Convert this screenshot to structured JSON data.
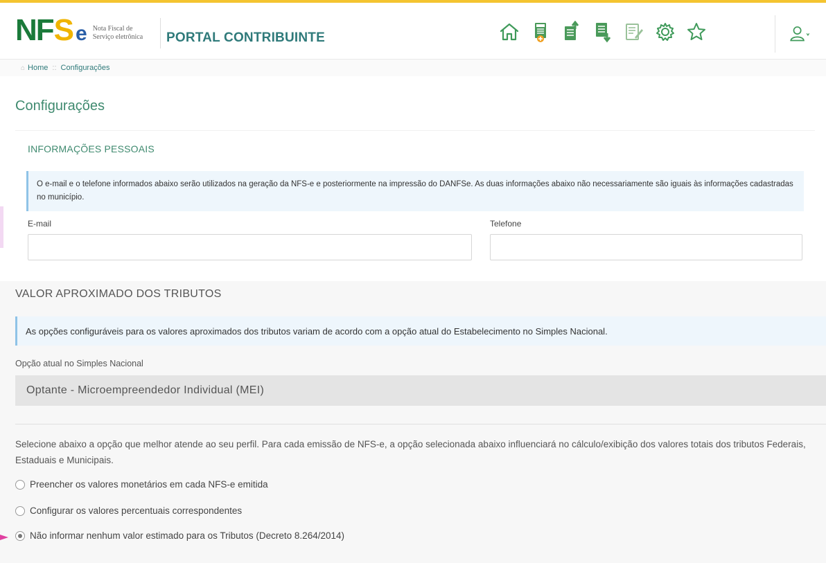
{
  "header": {
    "logo_nf": "NF",
    "logo_s": "S",
    "logo_e": "e",
    "logo_sub_1": "Nota Fiscal de",
    "logo_sub_2": "Serviço eletrônica",
    "portal_title": "PORTAL CONTRIBUINTE",
    "nav_icons": [
      "home-icon",
      "new-invoice-icon",
      "upload-invoice-icon",
      "download-invoice-icon",
      "edit-document-icon",
      "gear-icon",
      "star-icon"
    ],
    "accent_color": "#3f8a6f"
  },
  "breadcrumb": {
    "home": "Home",
    "separator": "::",
    "current": "Configurações"
  },
  "page": {
    "title": "Configurações"
  },
  "personal_info": {
    "title": "INFORMAÇÕES PESSOAIS",
    "notice": "O e-mail e o telefone informados abaixo serão utilizados na geração da NFS-e e posteriormente na impressão do DANFSe. As duas informações abaixo não necessariamente são iguais às informações cadastradas no município.",
    "email_label": "E-mail",
    "email_value": "",
    "phone_label": "Telefone",
    "phone_value": ""
  },
  "taxes": {
    "title": "VALOR APROXIMADO DOS TRIBUTOS",
    "notice": "As opções configuráveis para os valores aproximados dos tributos variam de acordo com a opção atual do Estabelecimento no Simples Nacional.",
    "simples_label": "Opção atual no Simples Nacional",
    "simples_value": "Optante - Microempreendedor Individual (MEI)",
    "description": "Selecione abaixo a opção que melhor atende ao seu perfil. Para cada emissão de NFS-e, a opção selecionada abaixo influenciará no cálculo/exibição dos valores totais dos tributos Federais, Estaduais e Municipais.",
    "options": [
      {
        "label": "Preencher os valores monetários em cada NFS-e emitida",
        "checked": false
      },
      {
        "label": "Configurar os valores percentuais correspondentes",
        "checked": false
      },
      {
        "label": "Não informar nenhum valor estimado para os Tributos (Decreto 8.264/2014)",
        "checked": true
      }
    ]
  }
}
